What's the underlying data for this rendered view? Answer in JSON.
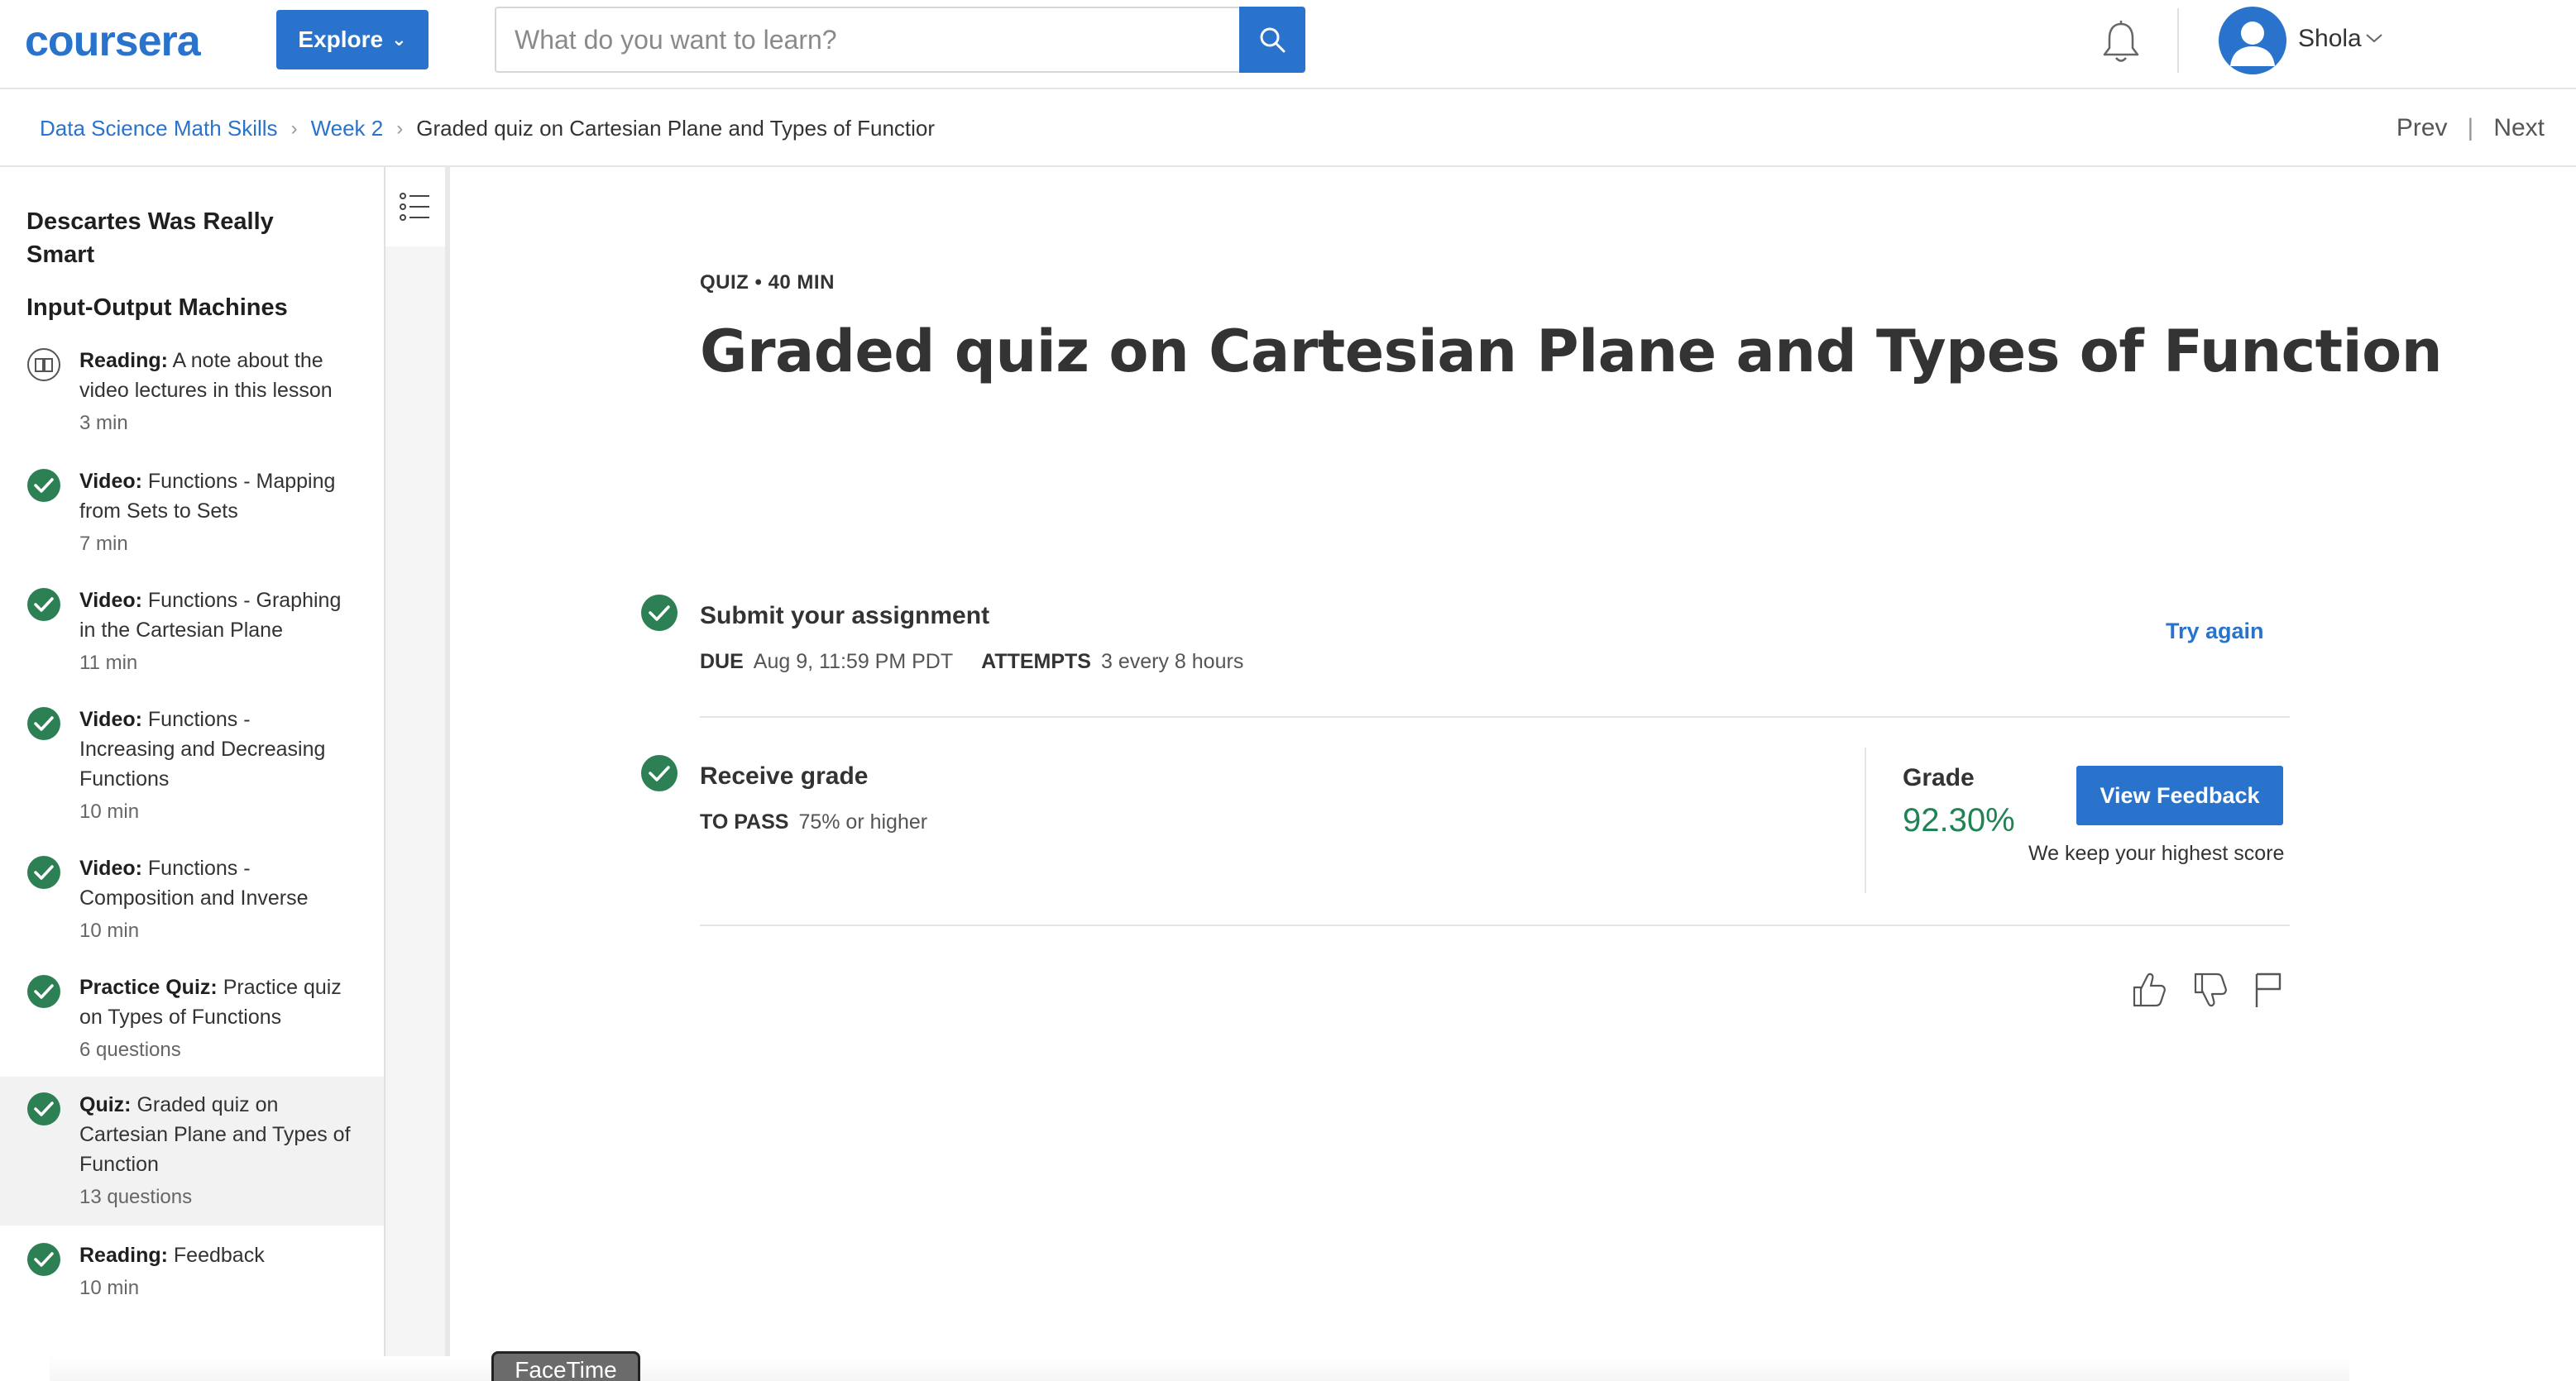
{
  "header": {
    "logo": "coursera",
    "explore_label": "Explore",
    "search_placeholder": "What do you want to learn?",
    "username": "Shola",
    "icons": {
      "search": "search-icon",
      "bell": "bell-icon",
      "avatar": "user-avatar-icon",
      "chevron": "chevron-down-icon"
    }
  },
  "breadcrumb": {
    "items": [
      "Data Science Math Skills",
      "Week 2"
    ],
    "current": "Graded quiz on Cartesian Plane and Types of Functior",
    "separator": "›",
    "prev": "Prev",
    "next": "Next",
    "divider": "|"
  },
  "sidebar": {
    "lessons": [
      "Descartes Was Really Smart",
      "Input-Output Machines"
    ],
    "items": [
      {
        "type": "Reading:",
        "title": "A note about the video lectures in this lesson",
        "meta": "3 min",
        "status": "reading-icon"
      },
      {
        "type": "Video:",
        "title": "Functions - Mapping from Sets to Sets",
        "meta": "7 min",
        "status": "completed-check-icon"
      },
      {
        "type": "Video:",
        "title": "Functions - Graphing in the Cartesian Plane",
        "meta": "11 min",
        "status": "completed-check-icon"
      },
      {
        "type": "Video:",
        "title": "Functions - Increasing and Decreasing Functions",
        "meta": "10 min",
        "status": "completed-check-icon"
      },
      {
        "type": "Video:",
        "title": "Functions - Composition and Inverse",
        "meta": "10 min",
        "status": "completed-check-icon"
      },
      {
        "type": "Practice Quiz:",
        "title": "Practice quiz on Types of Functions",
        "meta": "6 questions",
        "status": "completed-check-icon"
      },
      {
        "type": "Quiz:",
        "title": "Graded quiz on Cartesian Plane and Types of Function",
        "meta": "13 questions",
        "status": "completed-check-icon"
      },
      {
        "type": "Reading:",
        "title": "Feedback",
        "meta": "10 min",
        "status": "completed-check-icon"
      }
    ]
  },
  "main": {
    "kicker": "QUIZ • 40 MIN",
    "title": "Graded quiz on Cartesian Plane and Types of Function",
    "submit": {
      "title": "Submit your assignment",
      "due_label": "DUE",
      "due_value": "Aug 9, 11:59 PM PDT",
      "attempts_label": "ATTEMPTS",
      "attempts_value": "3 every 8 hours",
      "try_again": "Try again"
    },
    "receive": {
      "title": "Receive grade",
      "to_pass_label": "TO PASS",
      "to_pass_value": "75% or higher",
      "grade_label": "Grade",
      "grade_value": "92.30%",
      "view_feedback": "View Feedback",
      "keep_note": "We keep your highest score"
    },
    "feedback_icons": [
      "thumbs-up-icon",
      "thumbs-down-icon",
      "flag-icon"
    ]
  },
  "dock": {
    "facetime": "FaceTime"
  },
  "colors": {
    "brand": "#2a73cc",
    "success": "#1f8354",
    "check": "#2d7f54"
  }
}
